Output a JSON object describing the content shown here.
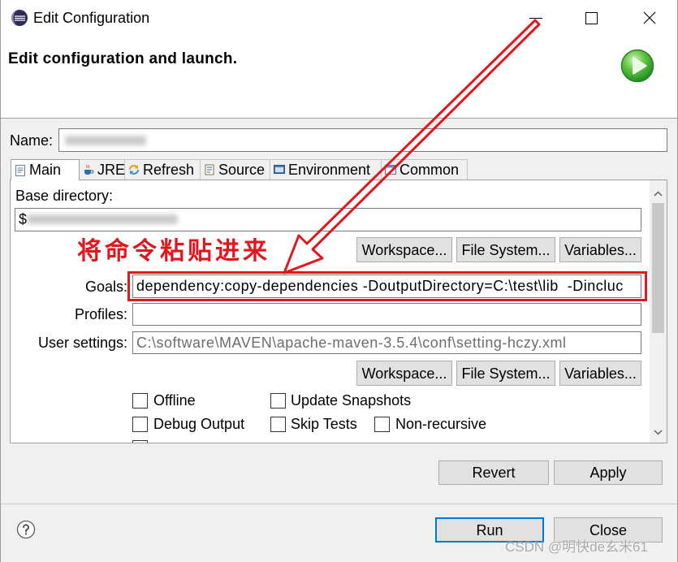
{
  "window": {
    "title": "Edit Configuration",
    "app_icon": "eclipse-icon",
    "minimize_icon": "minimize-icon",
    "maximize_icon": "maximize-icon",
    "close_icon": "close-icon"
  },
  "header": {
    "title": "Edit configuration and launch.",
    "icon": "run-launch-icon"
  },
  "name": {
    "label": "Name:"
  },
  "tabs": [
    {
      "label": "Main",
      "icon": "main-tab-icon",
      "selected": true
    },
    {
      "label": "JRE",
      "icon": "jre-icon",
      "selected": false
    },
    {
      "label": "Refresh",
      "icon": "refresh-icon",
      "selected": false
    },
    {
      "label": "Source",
      "icon": "source-icon",
      "selected": false
    },
    {
      "label": "Environment",
      "icon": "environment-icon",
      "selected": false
    },
    {
      "label": "Common",
      "icon": "common-icon",
      "selected": false
    }
  ],
  "main": {
    "base_directory": {
      "label": "Base directory:",
      "value_prefix": "$"
    },
    "annotation": "将命令粘贴进来",
    "annotation_arrow_icon": "red-arrow-icon",
    "directory_buttons": {
      "workspace": "Workspace...",
      "file_system": "File System...",
      "variables": "Variables..."
    },
    "goals": {
      "label": "Goals:",
      "value": "dependency:copy-dependencies -DoutputDirectory=C:\\test\\lib  -Dincluc",
      "highlighted": true
    },
    "profiles": {
      "label": "Profiles:",
      "value": ""
    },
    "user_settings": {
      "label": "User settings:",
      "value": "C:\\software\\MAVEN\\apache-maven-3.5.4\\conf\\setting-hczy.xml"
    },
    "settings_buttons": {
      "workspace": "Workspace...",
      "file_system": "File System...",
      "variables": "Variables..."
    },
    "options": [
      {
        "label": "Offline",
        "checked": false
      },
      {
        "label": "Update Snapshots",
        "checked": false
      },
      {
        "label": "Debug Output",
        "checked": false
      },
      {
        "label": "Skip Tests",
        "checked": false
      },
      {
        "label": "Non-recursive",
        "checked": false
      }
    ]
  },
  "actions": {
    "revert": "Revert",
    "apply": "Apply"
  },
  "footer": {
    "help_icon": "help-icon",
    "run": "Run",
    "close": "Close",
    "run_is_default": true
  },
  "watermark": "CSDN @明快de玄米61",
  "colors": {
    "annotation_red": "#e3161e",
    "default_button_border": "#0078d7",
    "launch_icon_green": "#2f9e2f",
    "panel_background": "#ffffff",
    "dialog_background": "#f0f0f0"
  }
}
